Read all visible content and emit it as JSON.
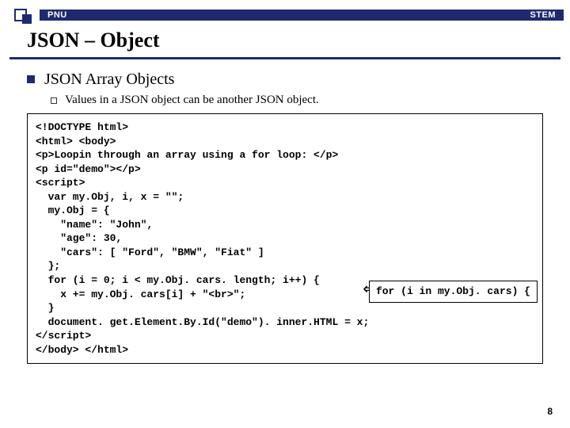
{
  "topbar": {
    "left": "PNU",
    "right": "STEM"
  },
  "title": "JSON – Object",
  "bullets": {
    "l1": "JSON Array Objects",
    "l2": "Values in a JSON object can be another JSON object."
  },
  "code": {
    "line1": "<!DOCTYPE html>",
    "line2": "<html> <body>",
    "line3": "<p>Loopin through an array using a for loop: </p>",
    "line4": "<p id=\"demo\"></p>",
    "line5": "<script>",
    "line6": "  var my.Obj, i, x = \"\";",
    "line7": "  my.Obj = {",
    "line8": "    \"name\": \"John\",",
    "line9": "    \"age\": 30,",
    "line10": "    \"cars\": [ \"Ford\", \"BMW\", \"Fiat\" ]",
    "line11": "  };",
    "line12": "  for (i = 0; i < my.Obj. cars. length; i++) {",
    "line13": "    x += my.Obj. cars[i] + \"<br>\";",
    "line14": "  }",
    "line15": "  document. get.Element.By.Id(\"demo\"). inner.HTML = x;",
    "line16": "</script>",
    "line17": "</body> </html>"
  },
  "altcode": "for (i in my.Obj. cars) {",
  "pagenum": "8"
}
